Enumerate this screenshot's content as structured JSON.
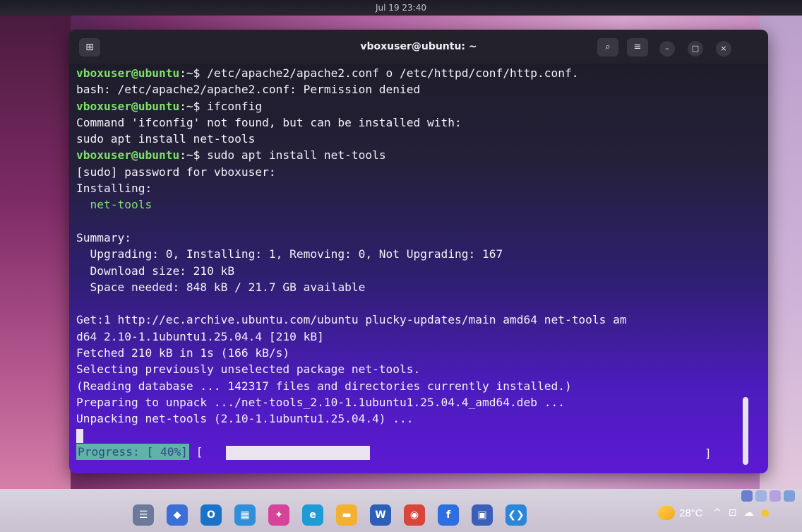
{
  "desktop": {
    "clock": "Jul 19  23:40"
  },
  "window": {
    "title": "vboxuser@ubuntu: ~",
    "new_tab_icon": "new-tab-icon",
    "search_icon": "search-icon",
    "menu_icon": "hamburger-menu-icon",
    "minimize_icon": "minimize-icon",
    "maximize_icon": "maximize-icon",
    "close_icon": "close-icon"
  },
  "terminal": {
    "prompt_user": "vboxuser@ubuntu",
    "prompt_sep": ":~$ ",
    "lines": [
      {
        "type": "cmd",
        "text": "/etc/apache2/apache2.conf o /etc/httpd/conf/http.conf."
      },
      {
        "type": "out",
        "text": "bash: /etc/apache2/apache2.conf: Permission denied"
      },
      {
        "type": "cmd",
        "text": "ifconfig"
      },
      {
        "type": "out",
        "text": "Command 'ifconfig' not found, but can be installed with:"
      },
      {
        "type": "out",
        "text": "sudo apt install net-tools"
      },
      {
        "type": "cmd",
        "text": "sudo apt install net-tools"
      },
      {
        "type": "out",
        "text": "[sudo] password for vboxuser:"
      },
      {
        "type": "out",
        "text": "Installing:"
      },
      {
        "type": "green",
        "text": "  net-tools"
      },
      {
        "type": "blank",
        "text": ""
      },
      {
        "type": "out",
        "text": "Summary:"
      },
      {
        "type": "out",
        "text": "  Upgrading: 0, Installing: 1, Removing: 0, Not Upgrading: 167"
      },
      {
        "type": "out",
        "text": "  Download size: 210 kB"
      },
      {
        "type": "out",
        "text": "  Space needed: 848 kB / 21.7 GB available"
      },
      {
        "type": "blank",
        "text": ""
      },
      {
        "type": "out",
        "text": "Get:1 http://ec.archive.ubuntu.com/ubuntu plucky-updates/main amd64 net-tools am"
      },
      {
        "type": "out",
        "text": "d64 2.10-1.1ubuntu1.25.04.4 [210 kB]"
      },
      {
        "type": "out",
        "text": "Fetched 210 kB in 1s (166 kB/s)"
      },
      {
        "type": "out",
        "text": "Selecting previously unselected package net-tools."
      },
      {
        "type": "out",
        "text": "(Reading database ... 142317 files and directories currently installed.)"
      },
      {
        "type": "out",
        "text": "Preparing to unpack .../net-tools_2.10-1.1ubuntu1.25.04.4_amd64.deb ..."
      },
      {
        "type": "out",
        "text": "Unpacking net-tools (2.10-1.1ubuntu1.25.04.4) ..."
      }
    ],
    "progress_label": "Progress: [ 40%]",
    "progress_open": "[",
    "progress_close": "]",
    "progress_fraction": 0.3
  },
  "taskbar": {
    "weather_temp": "28°C",
    "weather_icon": "partly-cloudy-icon",
    "icons": [
      {
        "name": "task-view-icon",
        "glyph": "☰",
        "color": "#6b7a9a"
      },
      {
        "name": "widgets-icon",
        "glyph": "◆",
        "color": "#3a6fd8"
      },
      {
        "name": "outlook-icon",
        "glyph": "O",
        "color": "#1a73c9"
      },
      {
        "name": "store-icon",
        "glyph": "▦",
        "color": "#2f8fd8"
      },
      {
        "name": "copilot-icon",
        "glyph": "✦",
        "color": "#d8439a"
      },
      {
        "name": "edge-icon",
        "glyph": "e",
        "color": "#1f9bd6"
      },
      {
        "name": "file-explorer-icon",
        "glyph": "▬",
        "color": "#f2b230"
      },
      {
        "name": "word-icon",
        "glyph": "W",
        "color": "#2b5fb8"
      },
      {
        "name": "chrome-icon",
        "glyph": "◉",
        "color": "#d8453a"
      },
      {
        "name": "facebook-icon",
        "glyph": "f",
        "color": "#2d6fe0"
      },
      {
        "name": "virtualbox-icon",
        "glyph": "▣",
        "color": "#3a5fb8"
      },
      {
        "name": "vscode-icon",
        "glyph": "❮❯",
        "color": "#2a86d8"
      }
    ]
  }
}
